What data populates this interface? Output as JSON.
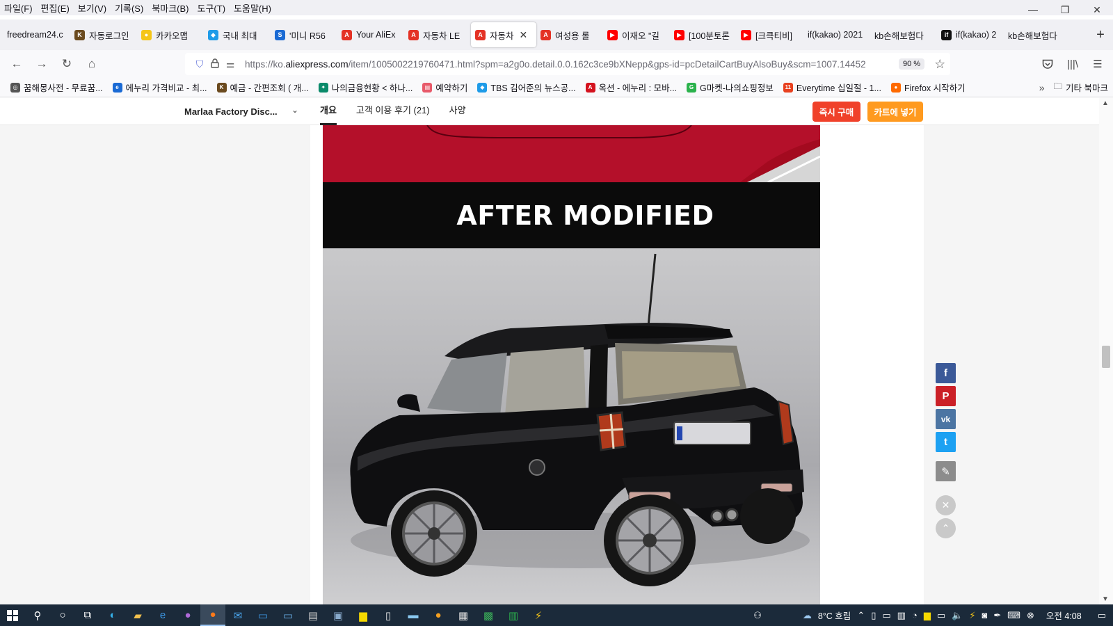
{
  "menu": [
    "파일(F)",
    "편집(E)",
    "보기(V)",
    "기록(S)",
    "북마크(B)",
    "도구(T)",
    "도움말(H)"
  ],
  "window_controls": {
    "minimize": "—",
    "restore": "❐",
    "close": "✕"
  },
  "tabs": [
    {
      "label": "freedream24.c",
      "fav_color": "",
      "fav_glyph": ""
    },
    {
      "label": "자동로그인",
      "fav_color": "#6b4a1f",
      "fav_glyph": "K"
    },
    {
      "label": "카카오맵",
      "fav_color": "#f5c518",
      "fav_glyph": "●"
    },
    {
      "label": "국내 최대",
      "fav_color": "#1e9be8",
      "fav_glyph": "◆"
    },
    {
      "label": "'미니 R56",
      "fav_color": "#1a6ad4",
      "fav_glyph": "S"
    },
    {
      "label": "Your AliEx",
      "fav_color": "#e43225",
      "fav_glyph": "A"
    },
    {
      "label": "자동차 LE",
      "fav_color": "#e43225",
      "fav_glyph": "A"
    },
    {
      "label": "자동차",
      "fav_color": "#e43225",
      "fav_glyph": "A",
      "active": true
    },
    {
      "label": "여성용 롤",
      "fav_color": "#e43225",
      "fav_glyph": "A"
    },
    {
      "label": "이재오 \"길",
      "fav_color": "#ff0000",
      "fav_glyph": "▶"
    },
    {
      "label": "[100분토론",
      "fav_color": "#ff0000",
      "fav_glyph": "▶"
    },
    {
      "label": "[크큭티비]",
      "fav_color": "#ff0000",
      "fav_glyph": "▶"
    },
    {
      "label": "if(kakao) 2021",
      "fav_color": "",
      "fav_glyph": ""
    },
    {
      "label": "kb손해보험다",
      "fav_color": "",
      "fav_glyph": ""
    },
    {
      "label": "if(kakao) 2",
      "fav_color": "#111111",
      "fav_glyph": "if"
    },
    {
      "label": "kb손해보험다",
      "fav_color": "",
      "fav_glyph": ""
    }
  ],
  "new_tab": "+",
  "nav": {
    "back": "←",
    "forward": "→",
    "reload": "↻",
    "home": "⌂",
    "url_prefix": "https://ko.",
    "url_domain": "aliexpress.com",
    "url_rest": "/item/1005002219760471.html?spm=a2g0o.detail.0.0.162c3ce9bXNepp&gps-id=pcDetailCartBuyAlsoBuy&scm=1007.14452",
    "zoom": "90 %"
  },
  "bookmarks": [
    {
      "label": "꿈해몽사전 - 무료꿈...",
      "fav_color": "#555555",
      "fav_glyph": "◎"
    },
    {
      "label": "에누리 가격비교 - 최...",
      "fav_color": "#1a6ad4",
      "fav_glyph": "e"
    },
    {
      "label": "예금 - 간편조회 ( 개...",
      "fav_color": "#6b4a1f",
      "fav_glyph": "K"
    },
    {
      "label": "나의금융현황 < 하나...",
      "fav_color": "#0a8a6a",
      "fav_glyph": "✦"
    },
    {
      "label": "예약하기",
      "fav_color": "#e85a6a",
      "fav_glyph": "▤"
    },
    {
      "label": "TBS 김어준의 뉴스공...",
      "fav_color": "#1e9be8",
      "fav_glyph": "◆"
    },
    {
      "label": "옥션 - 에누리 : 모바...",
      "fav_color": "#d4121e",
      "fav_glyph": "A"
    },
    {
      "label": "G마켓-나의쇼핑정보",
      "fav_color": "#2bb24c",
      "fav_glyph": "G"
    },
    {
      "label": "Everytime 십일절 - 1...",
      "fav_color": "#e8401f",
      "fav_glyph": "11"
    },
    {
      "label": "Firefox 시작하기",
      "fav_color": "#ff6a00",
      "fav_glyph": "●"
    }
  ],
  "bookmarks_more": "»",
  "bookmarks_other": "기타 북마크",
  "store": {
    "name": "Marlaa Factory Disc...",
    "chevron": "⌄"
  },
  "product_tabs": [
    "개요",
    "고객 이용 후기 (21)",
    "사양"
  ],
  "buy_now": "즉시 구매",
  "add_to_cart": "카트에 넣기",
  "banner_text": "AFTER MODIFIED",
  "share": [
    {
      "name": "facebook-icon",
      "glyph": "f",
      "color": "#3b5998"
    },
    {
      "name": "pinterest-icon",
      "glyph": "P",
      "color": "#cb2027"
    },
    {
      "name": "vk-icon",
      "glyph": "vk",
      "color": "#4c75a3"
    },
    {
      "name": "twitter-icon",
      "glyph": "t",
      "color": "#1da1f2"
    },
    {
      "name": "edit-icon",
      "glyph": "✎",
      "color": "#8c8c8c"
    }
  ],
  "close_glyph": "✕",
  "top_glyph": "⌃",
  "taskbar": {
    "weather": "8°C 흐림",
    "time": "오전 4:08"
  },
  "colors": {
    "buy_now": "#f0412a",
    "add_to_cart": "#ff9a1f"
  }
}
